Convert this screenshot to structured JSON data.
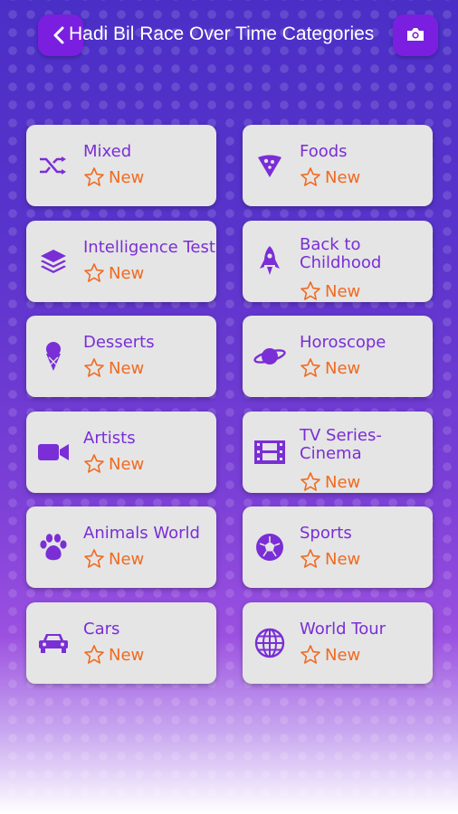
{
  "header": {
    "title": "Hadi Bil Race Over Time Categories",
    "back_icon": "chevron-left-icon",
    "camera_icon": "camera-icon"
  },
  "badge_label": "New",
  "colors": {
    "accent": "#7a2ed6",
    "badge": "#f06a20",
    "button": "#7a1fe0"
  },
  "categories": [
    {
      "label": "Mixed",
      "icon": "shuffle-icon"
    },
    {
      "label": "Foods",
      "icon": "pizza-icon"
    },
    {
      "label": "Intelligence Test",
      "icon": "layers-icon"
    },
    {
      "label": "Back to Childhood",
      "icon": "rocket-icon"
    },
    {
      "label": "Desserts",
      "icon": "ice-cream-icon"
    },
    {
      "label": "Horoscope",
      "icon": "planet-icon"
    },
    {
      "label": "Artists",
      "icon": "video-camera-icon"
    },
    {
      "label": "TV Series-Cinema",
      "icon": "film-icon"
    },
    {
      "label": "Animals World",
      "icon": "paw-icon"
    },
    {
      "label": "Sports",
      "icon": "soccer-ball-icon"
    },
    {
      "label": "Cars",
      "icon": "car-icon"
    },
    {
      "label": "World Tour",
      "icon": "globe-icon"
    }
  ]
}
